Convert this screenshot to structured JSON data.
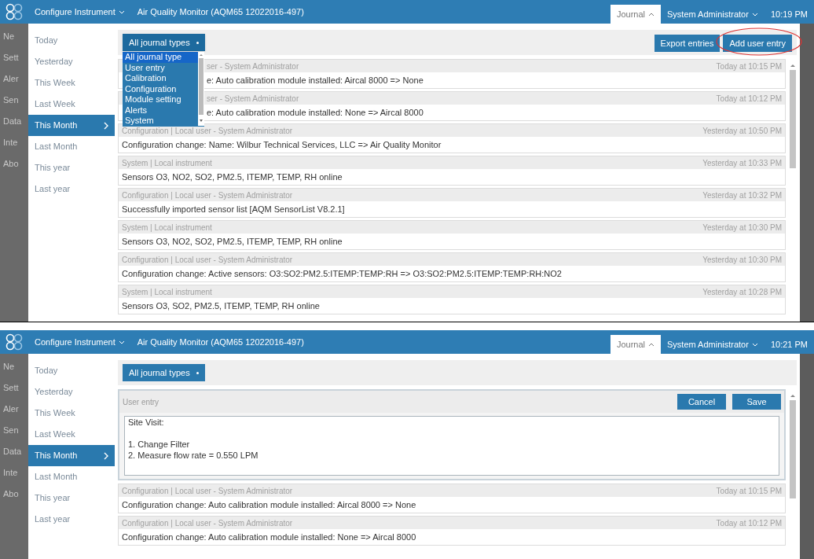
{
  "screens": [
    {
      "header": {
        "menu": "Configure Instrument",
        "title": "Air Quality Monitor (AQM65 12022016-497)",
        "tabs": [
          {
            "label": "Journal",
            "selected": true
          },
          {
            "label": "System Administrator",
            "selected": false
          }
        ],
        "time": "10:19 PM"
      },
      "background_menu": [
        "Ne",
        "Sett",
        "Aler",
        "Sen",
        "Data",
        "Inte",
        "Abo"
      ],
      "ranges": [
        {
          "label": "Today",
          "selected": false
        },
        {
          "label": "Yesterday",
          "selected": false
        },
        {
          "label": "This Week",
          "selected": false
        },
        {
          "label": "Last Week",
          "selected": false
        },
        {
          "label": "This Month",
          "selected": true
        },
        {
          "label": "Last Month",
          "selected": false
        },
        {
          "label": "This year",
          "selected": false
        },
        {
          "label": "Last year",
          "selected": false
        }
      ],
      "filter": {
        "label": "All journal types",
        "expanded": true,
        "options": [
          {
            "label": "All journal type",
            "selected": true
          },
          {
            "label": "User entry",
            "selected": false
          },
          {
            "label": "Calibration",
            "selected": false
          },
          {
            "label": "Configuration",
            "selected": false
          },
          {
            "label": "Module setting",
            "selected": false
          },
          {
            "label": "Alerts",
            "selected": false
          },
          {
            "label": "System",
            "selected": false
          }
        ]
      },
      "actions": [
        {
          "label": "Export entries",
          "highlighted": false
        },
        {
          "label": "Add user entry",
          "highlighted": true
        }
      ],
      "entries": [
        {
          "source": "ser - System Administrator",
          "time": "Today at 10:15 PM",
          "message": "e: Auto calibration module installed: Aircal 8000 => None"
        },
        {
          "source": "ser - System Administrator",
          "time": "Today at 10:12 PM",
          "message": "e: Auto calibration module installed: None => Aircal 8000"
        },
        {
          "source": "Configuration | Local user - System Administrator",
          "time": "Yesterday at 10:50 PM",
          "message": "Configuration change: Name: Wilbur Technical Services, LLC => Air Quality Monitor"
        },
        {
          "source": "System | Local instrument",
          "time": "Yesterday at 10:33 PM",
          "message": "Sensors O3, NO2, SO2, PM2.5, ITEMP, TEMP, RH online"
        },
        {
          "source": "Configuration | Local user - System Administrator",
          "time": "Yesterday at 10:32 PM",
          "message": "Successfully imported sensor list [AQM SensorList V8.2.1]"
        },
        {
          "source": "System | Local instrument",
          "time": "Yesterday at 10:30 PM",
          "message": "Sensors O3, NO2, SO2, PM2.5, ITEMP, TEMP, RH online"
        },
        {
          "source": "Configuration | Local user - System Administrator",
          "time": "Yesterday at 10:30 PM",
          "message": "Configuration change: Active sensors: O3:SO2:PM2.5:ITEMP:TEMP:RH => O3:SO2:PM2.5:ITEMP:TEMP:RH:NO2"
        },
        {
          "source": "System | Local instrument",
          "time": "Yesterday at 10:28 PM",
          "message": "Sensors O3, SO2, PM2.5, ITEMP, TEMP, RH online"
        }
      ]
    },
    {
      "header": {
        "menu": "Configure Instrument",
        "title": "Air Quality Monitor (AQM65 12022016-497)",
        "tabs": [
          {
            "label": "Journal",
            "selected": true
          },
          {
            "label": "System Administrator",
            "selected": false
          }
        ],
        "time": "10:21 PM"
      },
      "background_menu": [
        "Ne",
        "Sett",
        "Aler",
        "Sen",
        "Data",
        "Inte",
        "Abo"
      ],
      "ranges": [
        {
          "label": "Today",
          "selected": false
        },
        {
          "label": "Yesterday",
          "selected": false
        },
        {
          "label": "This Week",
          "selected": false
        },
        {
          "label": "Last Week",
          "selected": false
        },
        {
          "label": "This Month",
          "selected": true
        },
        {
          "label": "Last Month",
          "selected": false
        },
        {
          "label": "This year",
          "selected": false
        },
        {
          "label": "Last year",
          "selected": false
        }
      ],
      "filter": {
        "label": "All journal types",
        "expanded": false
      },
      "editor": {
        "title": "User entry",
        "buttons": [
          "Cancel",
          "Save"
        ],
        "value": "Site Visit:\n\n1. Change Filter\n2. Measure flow rate = 0.550 LPM"
      },
      "entries": [
        {
          "source": "Configuration | Local user - System Administrator",
          "time": "Today at 10:15 PM",
          "message": "Configuration change: Auto calibration module installed: Aircal 8000 => None"
        },
        {
          "source": "Configuration | Local user - System Administrator",
          "time": "Today at 10:12 PM",
          "message": "Configuration change: Auto calibration module installed: None => Aircal 8000"
        }
      ]
    }
  ]
}
